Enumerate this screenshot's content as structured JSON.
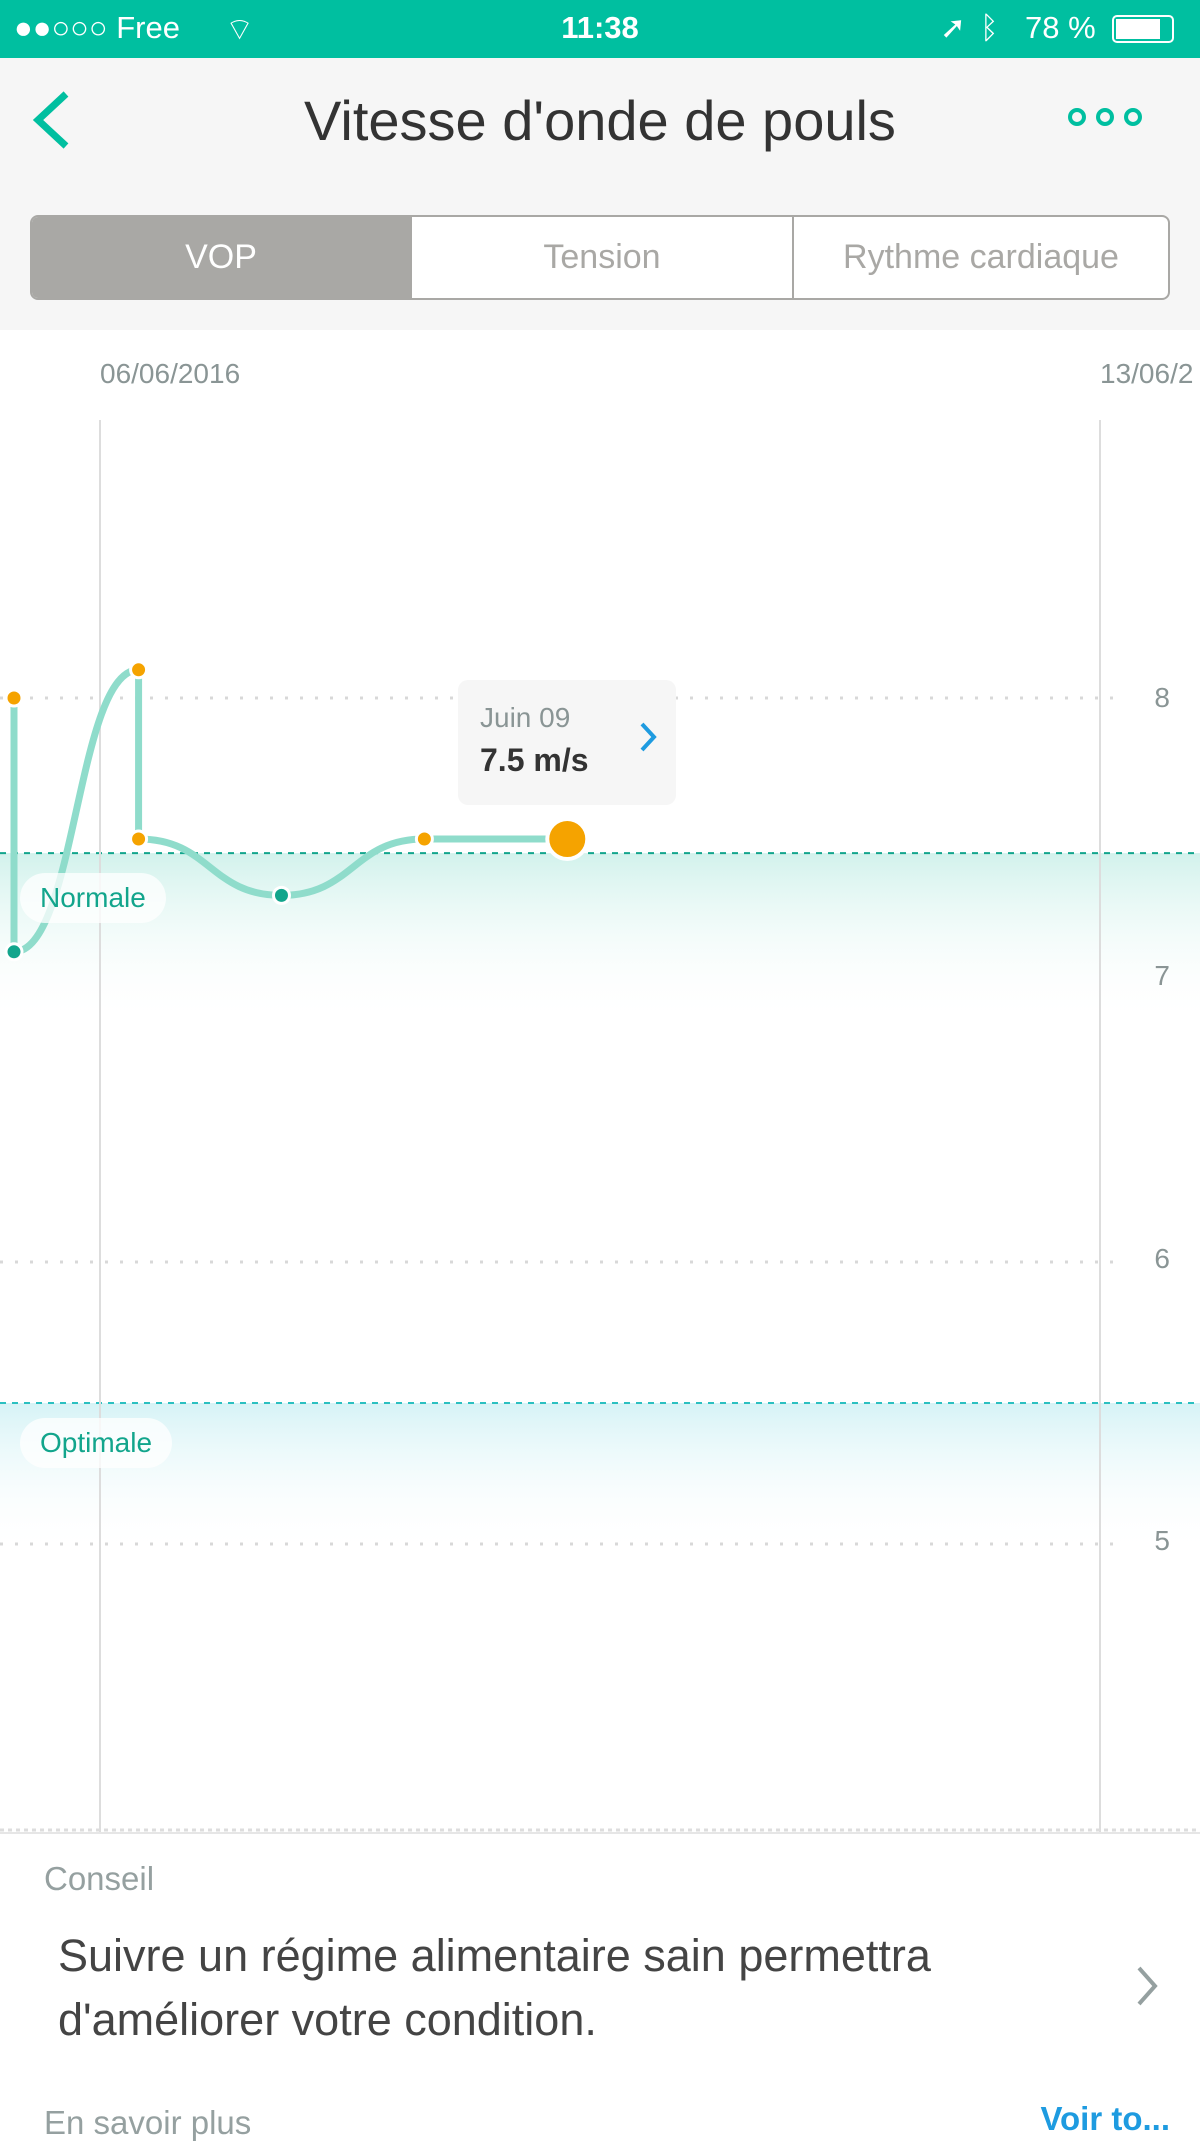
{
  "status_bar": {
    "carrier": "●●○○○ Free",
    "time": "11:38",
    "battery": "78 %"
  },
  "header": {
    "title": "Vitesse d'onde de pouls"
  },
  "tabs": [
    {
      "label": "VOP",
      "selected": true
    },
    {
      "label": "Tension",
      "selected": false
    },
    {
      "label": "Rythme cardiaque",
      "selected": false
    }
  ],
  "colors": {
    "accent": "#00bfa0",
    "point_high": "#f5a300",
    "point_normal": "#12a58c",
    "line": "#8fdccb",
    "link": "#1e9be0"
  },
  "chart_data": {
    "type": "line",
    "x_labels": [
      "06/06/2016",
      "13/06/2"
    ],
    "y_ticks": [
      "8",
      "7",
      "6",
      "5"
    ],
    "ylim": [
      4,
      8.9
    ],
    "zones": [
      {
        "label": "Normale",
        "threshold": 7.45
      },
      {
        "label": "Optimale",
        "threshold": 5.5
      }
    ],
    "points": [
      {
        "date": "2016-06-05",
        "value": 8.0,
        "status": "high"
      },
      {
        "date": "2016-06-05",
        "value": 7.1,
        "status": "normal"
      },
      {
        "date": "2016-06-06",
        "value": 8.1,
        "status": "high"
      },
      {
        "date": "2016-06-06",
        "value": 7.5,
        "status": "high"
      },
      {
        "date": "2016-06-07",
        "value": 7.3,
        "status": "normal"
      },
      {
        "date": "2016-06-08",
        "value": 7.5,
        "status": "high"
      },
      {
        "date": "2016-06-09",
        "value": 7.5,
        "status": "high",
        "selected": true
      }
    ],
    "tooltip": {
      "date": "Juin 09",
      "value": "7.5 m/s"
    }
  },
  "advice": {
    "heading": "Conseil",
    "text": "Suivre un régime alimentaire sain permettra d'améliorer votre condition."
  },
  "footer": {
    "learn_more": "En savoir plus",
    "see_all": "Voir to..."
  }
}
